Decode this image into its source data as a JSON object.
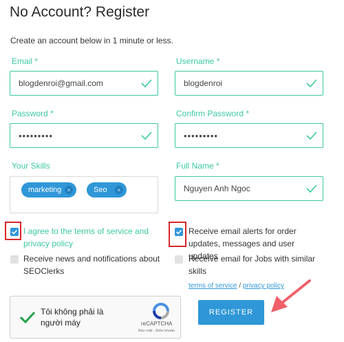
{
  "page": {
    "title": "No Account? Register",
    "subtitle": "Create an account below in 1 minute or less."
  },
  "form": {
    "email": {
      "label": "Email *",
      "value": "blogdenroi@gmail.com"
    },
    "username": {
      "label": "Username *",
      "value": "blogdenroi"
    },
    "password": {
      "label": "Password *",
      "value": "•••••••••"
    },
    "confirm_password": {
      "label": "Confirm Password *",
      "value": "•••••••••"
    },
    "skills": {
      "label": "Your Skills",
      "tags": [
        "marketing",
        "Seo"
      ],
      "remove_glyph": "×"
    },
    "full_name": {
      "label": "Full Name *",
      "value": "Nguyen Anh Ngoc"
    }
  },
  "checkboxes": {
    "terms": {
      "label": "I agree to the terms of service and privacy policy",
      "checked": true
    },
    "news": {
      "label": "Receive news and notifications about SEOClerks",
      "checked": false
    },
    "alerts": {
      "label": "Receive email alerts for order updates, messages and user updates",
      "checked": true
    },
    "jobs": {
      "label": "Receive email for Jobs with similar skills",
      "checked": false
    }
  },
  "links": {
    "terms_of_service": "terms of service",
    "separator": "/",
    "privacy_policy": "privacy policy"
  },
  "captcha": {
    "label": "Tôi không phải là người máy",
    "brand": "reCAPTCHA",
    "terms": "Bảo mật - Điều khoản",
    "checked": true
  },
  "register_button": {
    "label": "REGISTER"
  },
  "colors": {
    "accent_green": "#3cc8a2",
    "primary_blue": "#2f97d8",
    "highlight_red": "#d7282c",
    "arrow": "#f0606a"
  },
  "icons": [
    "check-icon",
    "remove-tag-icon",
    "recaptcha-logo-icon",
    "arrow-icon"
  ]
}
